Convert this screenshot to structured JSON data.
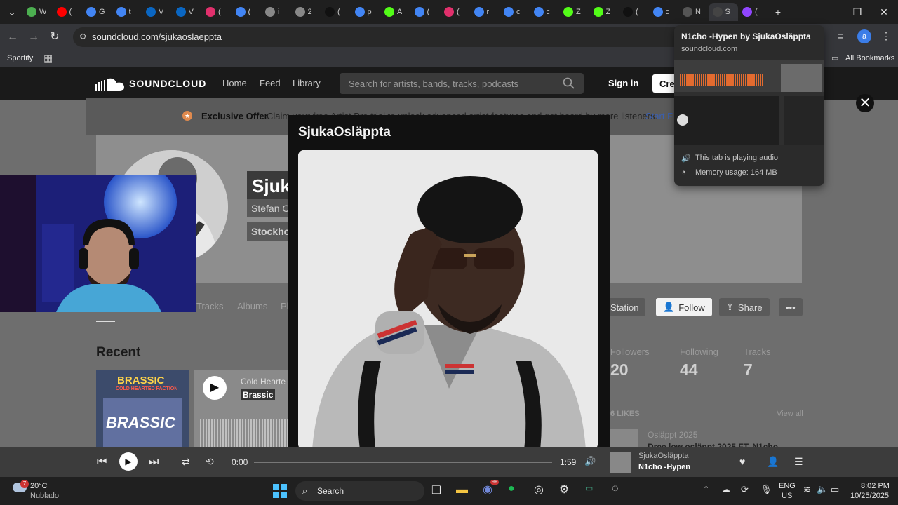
{
  "tabs": {
    "labels": [
      "W",
      "(",
      "G",
      "t",
      "V",
      "V",
      "(",
      "(",
      "i",
      "2",
      "(",
      "p",
      "A",
      "(",
      "(",
      "r",
      "c",
      "c",
      "Z",
      "Z",
      "(",
      "c",
      "N",
      "S",
      "("
    ],
    "active_label": "S"
  },
  "toolbar": {
    "url": "soundcloud.com/sjukaoslaeppta",
    "bookmarks_label": "Sportify",
    "all_bookmarks": "All Bookmarks",
    "profile_initial": "a"
  },
  "sc_header": {
    "logo": "SOUNDCLOUD",
    "nav": [
      "Home",
      "Feed",
      "Library"
    ],
    "search_placeholder": "Search for artists, bands, tracks, podcasts",
    "sign_in": "Sign in",
    "create": "Cre"
  },
  "offer": {
    "bold": "Exclusive Offer.",
    "text": "Claim your free Artist Pro trial to unlock advanced artist features and get heard by more listeners.",
    "link": "Start F"
  },
  "profile": {
    "name_partial": "Sjuka",
    "subtitle_partial": "Stefan C",
    "location_partial": "Stockho",
    "tabs": [
      "Tracks",
      "Albums",
      "Pl"
    ],
    "station": "Station",
    "follow": "Follow",
    "share": "Share",
    "more": "•••",
    "recent": "Recent",
    "stats": [
      {
        "label": "Followers",
        "value": "20"
      },
      {
        "label": "Following",
        "value": "44"
      },
      {
        "label": "Tracks",
        "value": "7"
      }
    ],
    "likes_label": "6 LIKES",
    "view_all": "View all",
    "like_item_1_title": "Osläppt 2025",
    "like_item_1_sub": "Dree low osläppt 2025 FT. N1cho"
  },
  "recent_cards": {
    "card_1_title": "BRASSIC",
    "card_1_sub": "COLD HEARTED FACTION",
    "card_2_artist": "Cold Hearte",
    "card_2_title": "Brassic"
  },
  "modal": {
    "title": "SjukaOsläppta"
  },
  "player": {
    "time_current": "0:00",
    "time_total": "1:59",
    "artist": "SjukaOsläppta",
    "track": "N1cho -Hypen",
    "progress": 0
  },
  "hovercard": {
    "title": "N1cho -Hypen by SjukaOsläppta",
    "domain": "soundcloud.com",
    "audio": "This tab is playing audio",
    "memory": "Memory usage: 164 MB"
  },
  "taskbar": {
    "weather_temp": "20°C",
    "weather_desc": "Nublado",
    "weather_badge": "7",
    "search": "Search",
    "lang": "ENG",
    "region": "US",
    "time": "8:02 PM",
    "date": "10/25/2025",
    "discord_badge": "9+"
  },
  "colors": {
    "sc_orange": "#ff5500",
    "follow_bg": "#ffffff",
    "chrome_dark": "#1f1f1f"
  }
}
